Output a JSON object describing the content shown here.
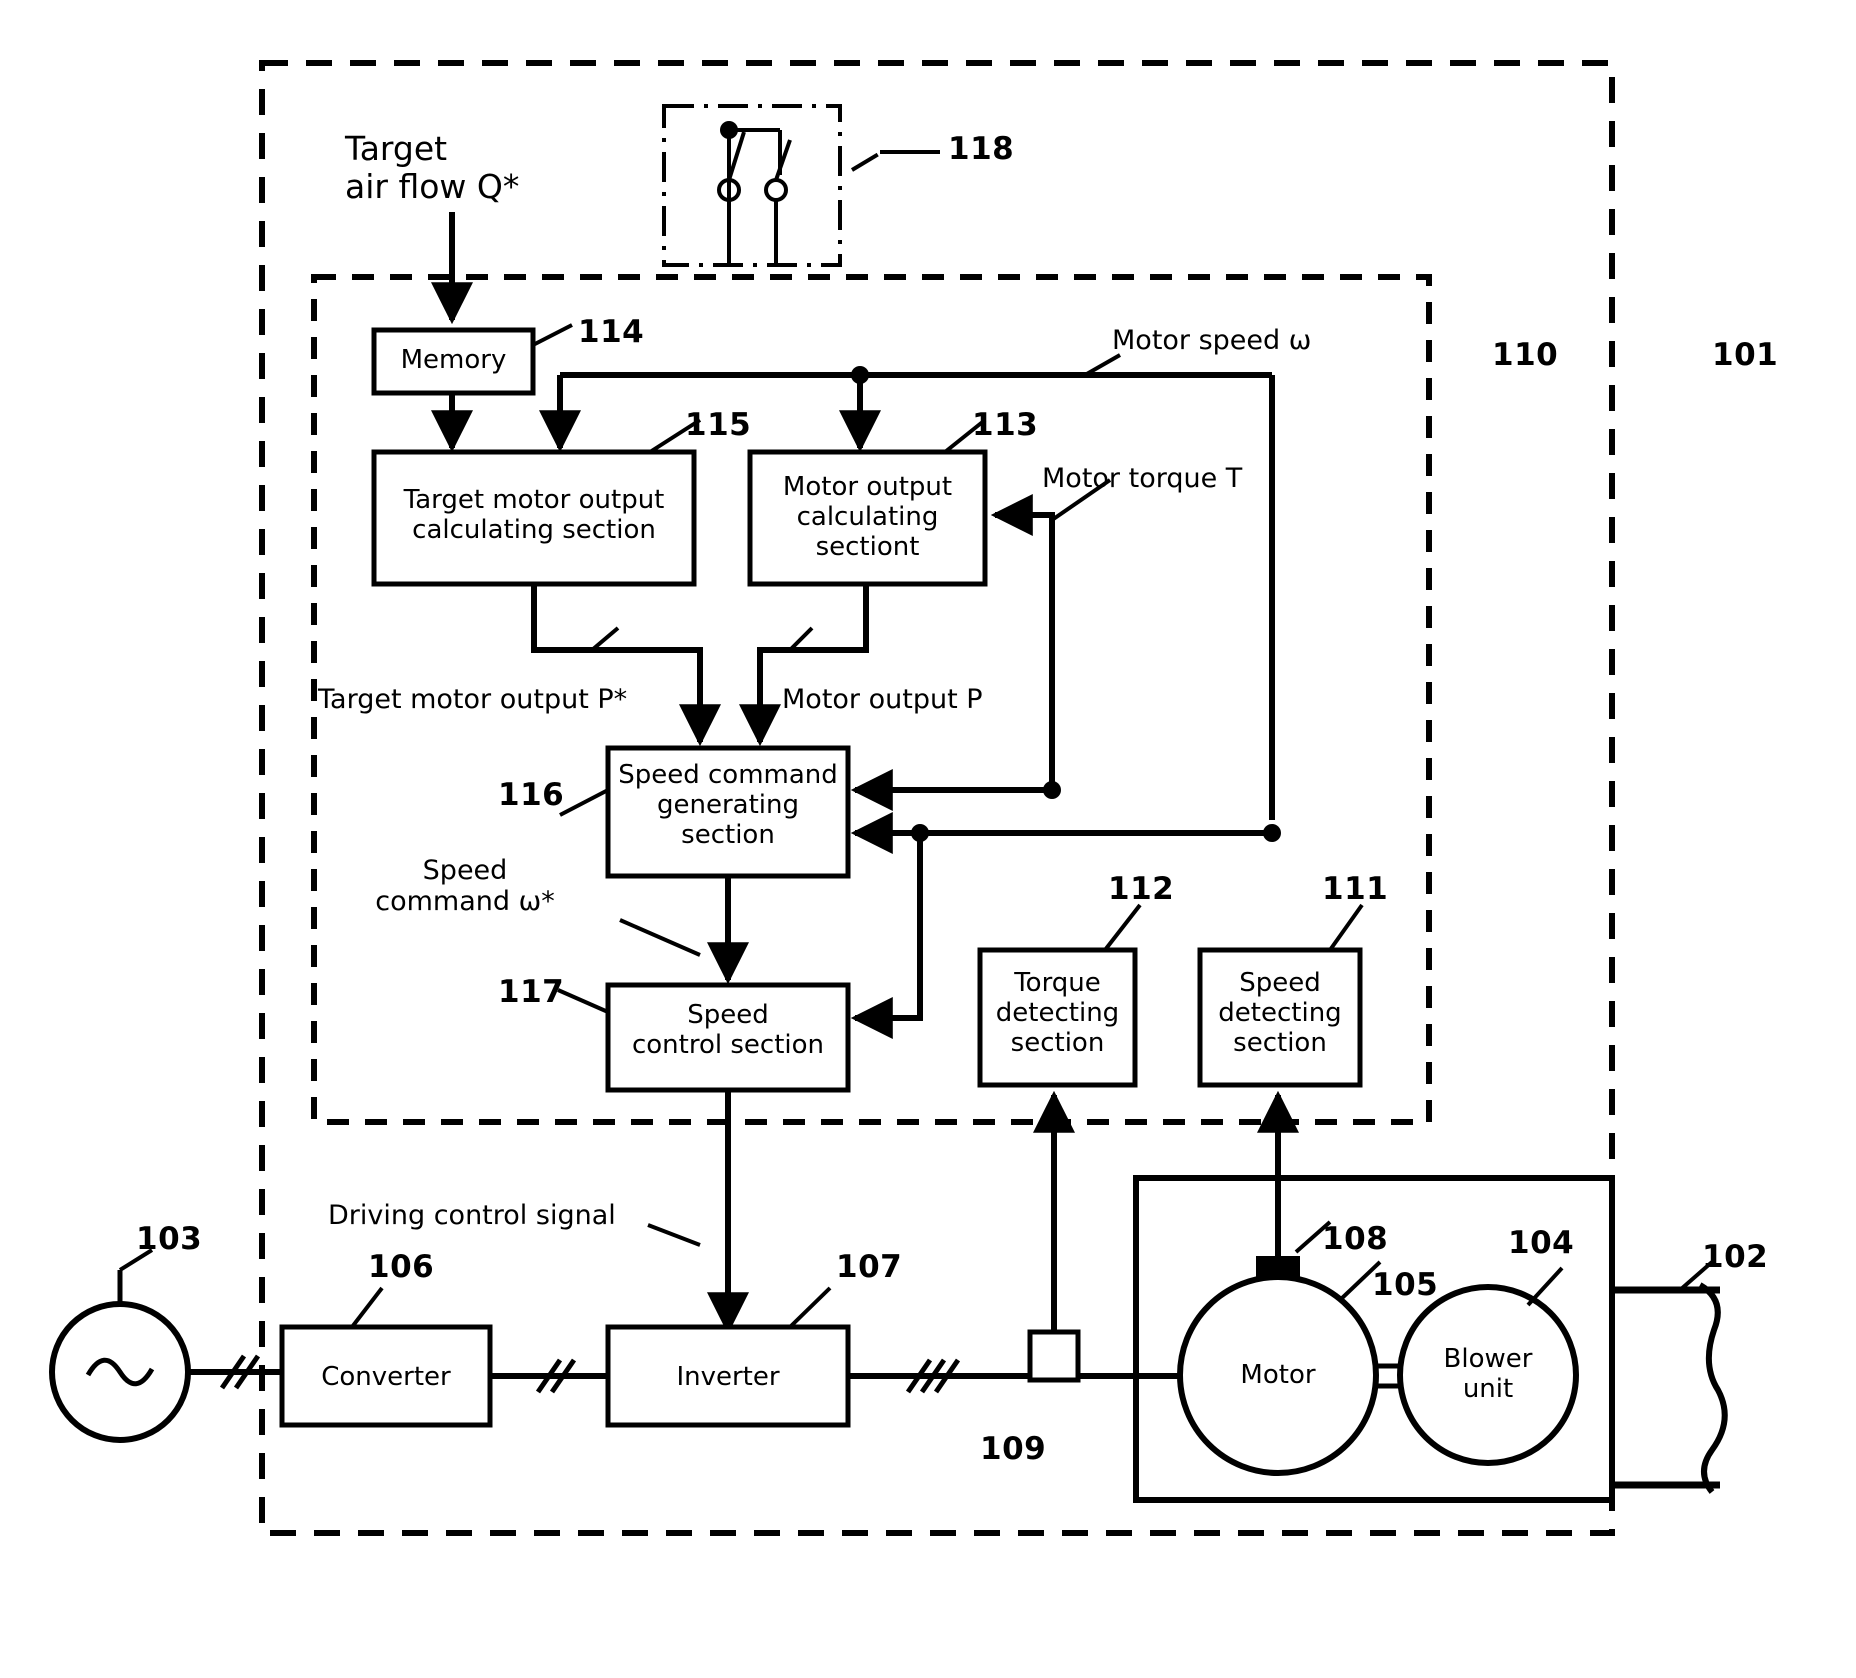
{
  "figure": {
    "type": "block-diagram",
    "title": "Blower motor control system block diagram"
  },
  "inputs": {
    "target_air_flow": "Target\nair flow Q*"
  },
  "blocks": {
    "memory": "Memory",
    "target_motor_output_calc": "Target motor output\ncalculating section",
    "motor_output_calc": "Motor output\ncalculating\nsectiont",
    "speed_command_generating": "Speed command\ngenerating\nsection",
    "speed_control": "Speed\ncontrol section",
    "torque_detecting": "Torque\ndetecting\nsection",
    "speed_detecting": "Speed\ndetecting\nsection",
    "converter": "Converter",
    "inverter": "Inverter",
    "motor": "Motor",
    "blower_unit": "Blower\nunit"
  },
  "signal_labels": {
    "motor_speed": "Motor speed ω",
    "motor_torque": "Motor torque T",
    "target_motor_output": "Target motor output P*",
    "motor_output": "Motor output P",
    "speed_command": "Speed\ncommand ω*",
    "driving_control_signal": "Driving control signal"
  },
  "reference_numerals": {
    "n101": "101",
    "n102": "102",
    "n103": "103",
    "n104": "104",
    "n105": "105",
    "n106": "106",
    "n107": "107",
    "n108": "108",
    "n109": "109",
    "n110": "110",
    "n111": "111",
    "n112": "112",
    "n113": "113",
    "n114": "114",
    "n115": "115",
    "n116": "116",
    "n117": "117",
    "n118": "118"
  },
  "colors": {
    "line": "#000000",
    "background": "#ffffff"
  }
}
